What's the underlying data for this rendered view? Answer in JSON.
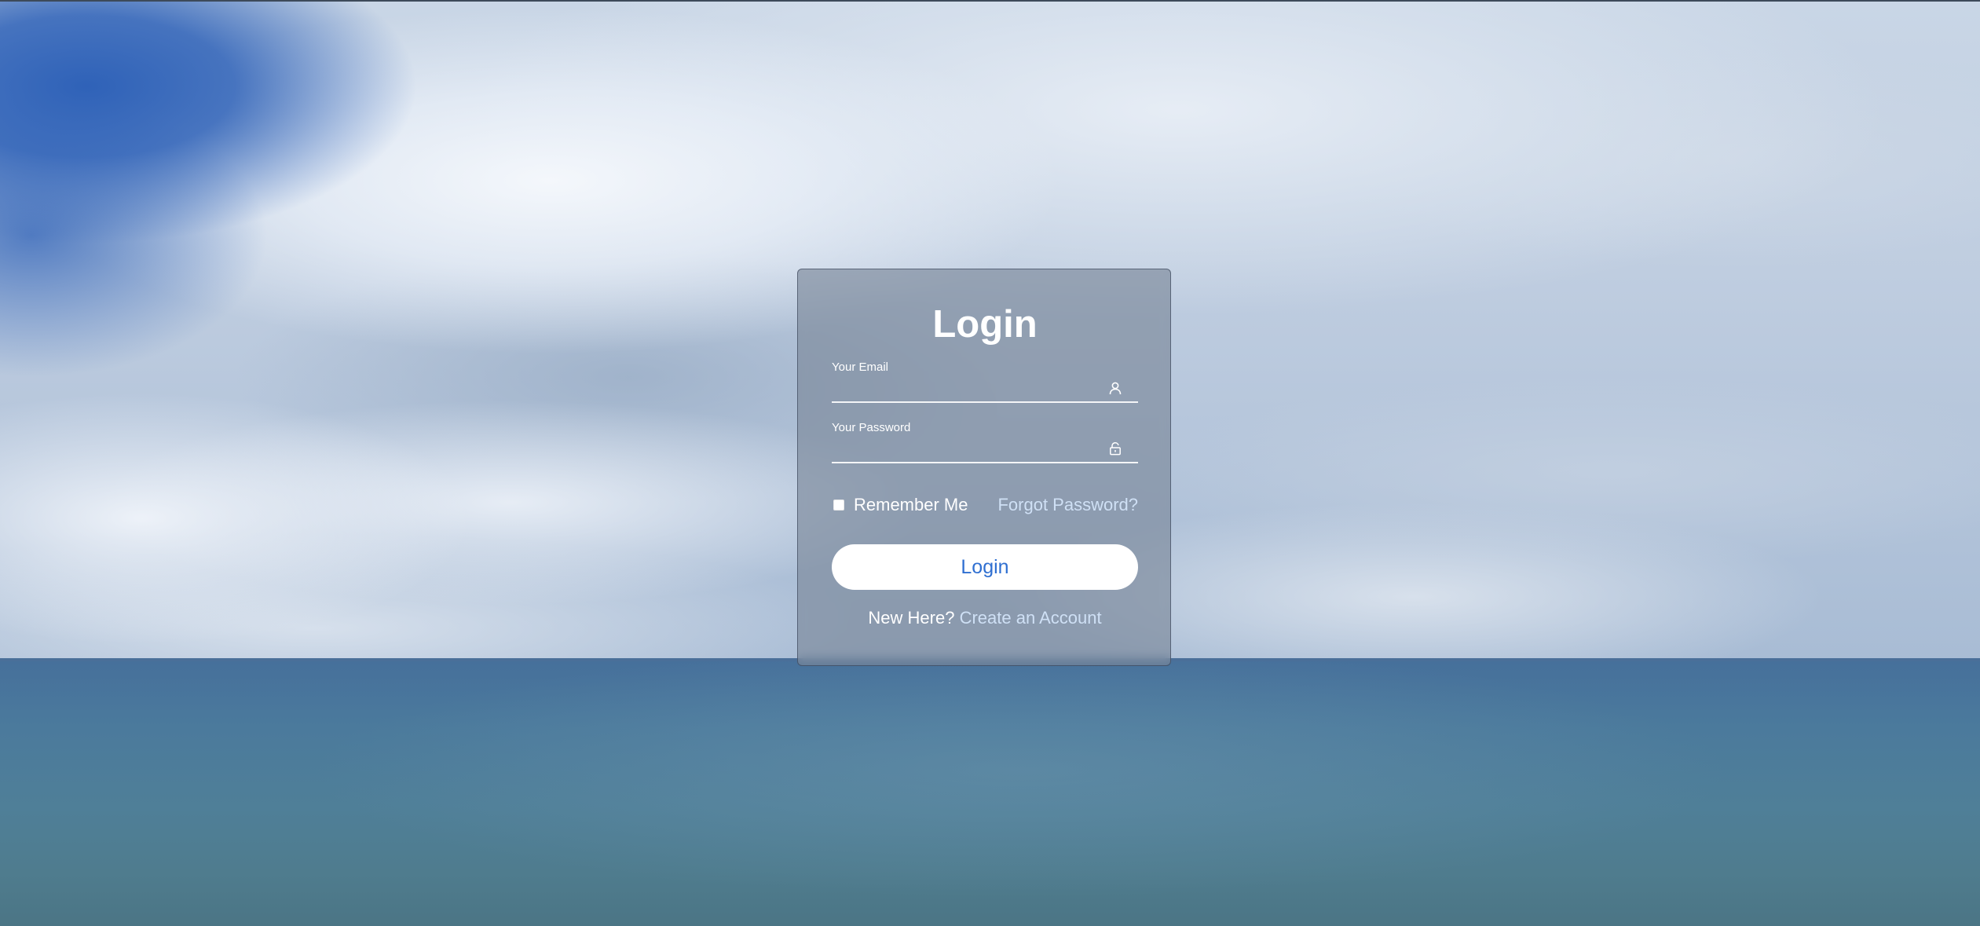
{
  "login_card": {
    "title": "Login",
    "email": {
      "label": "Your Email",
      "value": "",
      "icon": "user-icon"
    },
    "password": {
      "label": "Your Password",
      "value": "",
      "icon": "lock-icon"
    },
    "remember_me": {
      "label": "Remember Me",
      "checked": false
    },
    "forgot_password_label": "Forgot Password?",
    "login_button_label": "Login",
    "signup_prompt": "New Here?",
    "signup_link_label": "Create an Account"
  },
  "colors": {
    "button_text": "#2f6fd1",
    "link": "#cfe0f5",
    "card_background": "rgba(120,132,150,0.62)"
  }
}
